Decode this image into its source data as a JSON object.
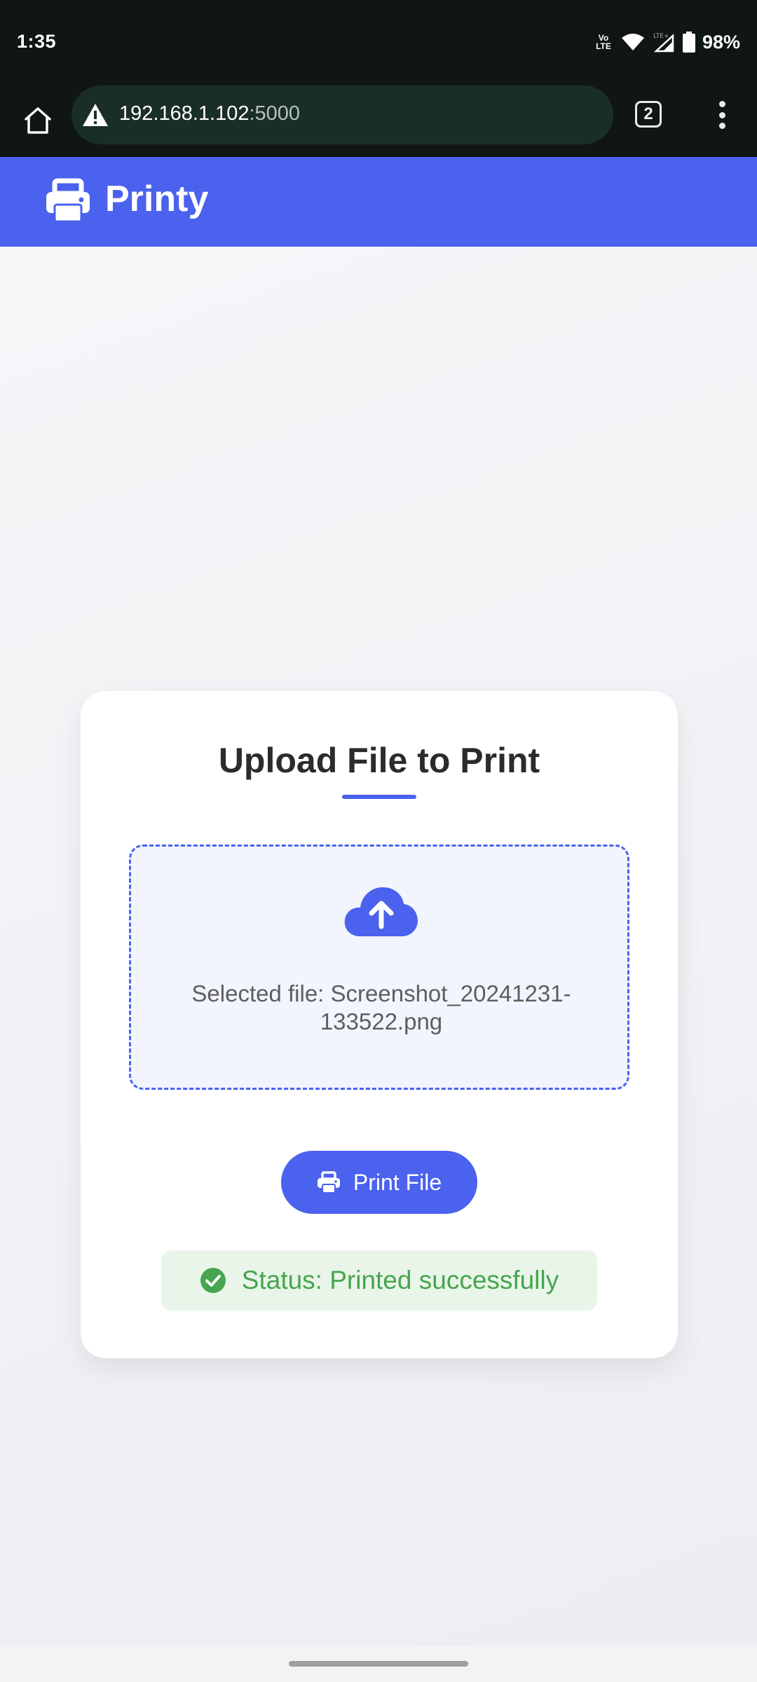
{
  "status_bar": {
    "time": "1:35",
    "volte_top": "Vo",
    "volte_bottom": "LTE",
    "battery": "98%",
    "icons": [
      "volte-icon",
      "wifi-icon",
      "signal-lte-icon",
      "battery-icon"
    ]
  },
  "browser": {
    "url_host": "192.168.1.102",
    "url_port": ":5000",
    "tab_count": "2",
    "icons": [
      "home-icon",
      "not-secure-warning-icon",
      "tab-switcher-icon",
      "more-menu-icon"
    ]
  },
  "app": {
    "title": "Printy",
    "logo_icon": "printer-icon",
    "brand_color": "#4a62ee"
  },
  "upload_card": {
    "title": "Upload File to Print",
    "upload_icon": "cloud-upload-icon",
    "selected_file_line1": "Selected file: Screenshot_20241231-",
    "selected_file_line2": "133522.png",
    "print_button_label": "Print File",
    "status_text": "Status: Printed successfully",
    "status_icon": "check-circle-icon",
    "status_color": "#46a54e"
  }
}
